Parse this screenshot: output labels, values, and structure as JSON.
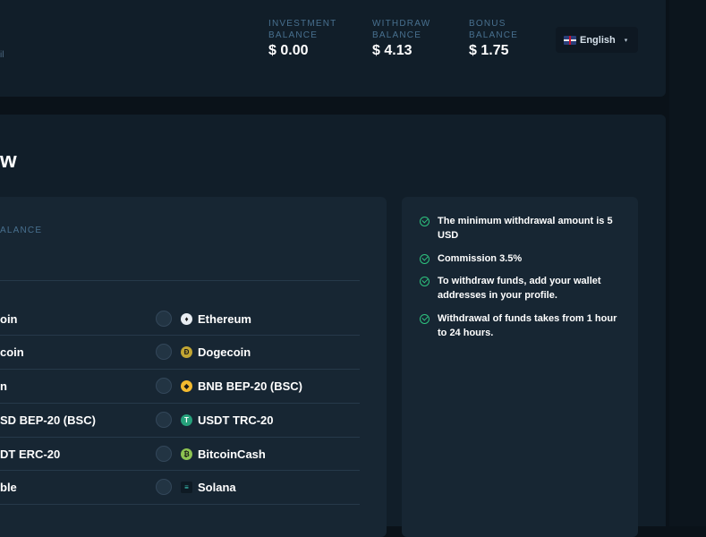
{
  "header": {
    "sub_text": "il",
    "balances": [
      {
        "label": "INVESTMENT BALANCE",
        "value": "$ 0.00"
      },
      {
        "label": "WITHDRAW BALANCE",
        "value": "$ 4.13"
      },
      {
        "label": "BONUS BALANCE",
        "value": "$ 1.75"
      }
    ],
    "language": {
      "label": "English",
      "caret": "▾"
    }
  },
  "page": {
    "title": "w"
  },
  "form": {
    "balance_label": "ALANCE",
    "left_options": [
      "oin",
      "coin",
      "n",
      "SD BEP-20 (BSC)",
      "DT ERC-20",
      "ble"
    ],
    "right_options": [
      {
        "label": "Ethereum",
        "icon": "ethereum-icon",
        "color": "#e8edf2",
        "glyph": "♦"
      },
      {
        "label": "Dogecoin",
        "icon": "dogecoin-icon",
        "color": "#c2a633",
        "glyph": "Ð"
      },
      {
        "label": "BNB BEP-20 (BSC)",
        "icon": "bnb-icon",
        "color": "#f3ba2f",
        "glyph": "◆"
      },
      {
        "label": "USDT TRC-20",
        "icon": "tether-icon",
        "color": "#26a17b",
        "glyph": "T"
      },
      {
        "label": "BitcoinCash",
        "icon": "bitcoincash-icon",
        "color": "#8dc351",
        "glyph": "₿"
      },
      {
        "label": "Solana",
        "icon": "solana-icon",
        "color": "#0e1a24",
        "glyph": "≡"
      }
    ]
  },
  "info": {
    "items": [
      "The minimum withdrawal amount is 5 USD",
      "Commission 3.5%",
      "To withdraw funds, add your wallet addresses in your profile.",
      "Withdrawal of funds takes from 1 hour to 24 hours."
    ]
  },
  "colors": {
    "accent_green": "#2ec27e",
    "panel": "#111e29",
    "card": "#172633"
  }
}
